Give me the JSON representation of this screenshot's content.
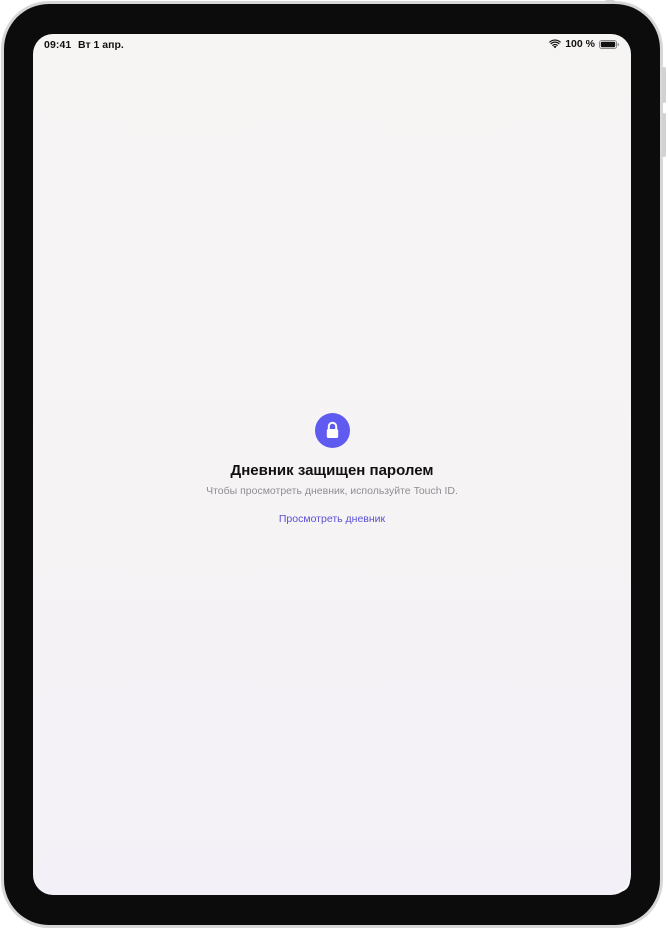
{
  "status_bar": {
    "time": "09:41",
    "date": "Вт 1 апр.",
    "battery_percent": "100 %",
    "wifi_icon": "wifi-icon",
    "battery_icon": "battery-icon"
  },
  "lock_screen": {
    "icon": "lock-icon",
    "accent_color": "#5f5af0",
    "title": "Дневник защищен паролем",
    "subtitle": "Чтобы просмотреть дневник, используйте Touch ID.",
    "action_label": "Просмотреть дневник"
  }
}
